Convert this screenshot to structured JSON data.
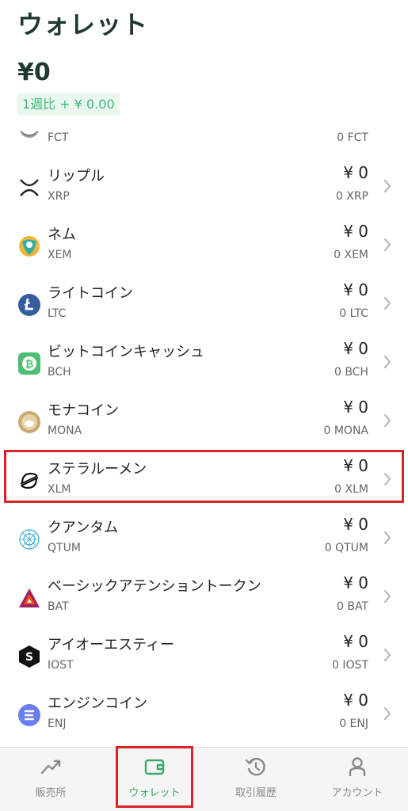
{
  "header": {
    "title": "ウォレット",
    "total": "¥0",
    "weekly_change": "1週比 + ¥ 0.00"
  },
  "coins": [
    {
      "name": "",
      "symbol": "FCT",
      "value": "",
      "amount": "0 FCT",
      "icon": "factom-icon"
    },
    {
      "name": "リップル",
      "symbol": "XRP",
      "value": "¥ 0",
      "amount": "0 XRP",
      "icon": "ripple-icon"
    },
    {
      "name": "ネム",
      "symbol": "XEM",
      "value": "¥ 0",
      "amount": "0 XEM",
      "icon": "nem-icon"
    },
    {
      "name": "ライトコイン",
      "symbol": "LTC",
      "value": "¥ 0",
      "amount": "0 LTC",
      "icon": "litecoin-icon"
    },
    {
      "name": "ビットコインキャッシュ",
      "symbol": "BCH",
      "value": "¥ 0",
      "amount": "0 BCH",
      "icon": "bitcoin-cash-icon"
    },
    {
      "name": "モナコイン",
      "symbol": "MONA",
      "value": "¥ 0",
      "amount": "0 MONA",
      "icon": "monacoin-icon"
    },
    {
      "name": "ステラルーメン",
      "symbol": "XLM",
      "value": "¥ 0",
      "amount": "0 XLM",
      "icon": "stellar-icon"
    },
    {
      "name": "クアンタム",
      "symbol": "QTUM",
      "value": "¥ 0",
      "amount": "0 QTUM",
      "icon": "qtum-icon"
    },
    {
      "name": "ベーシックアテンショントークン",
      "symbol": "BAT",
      "value": "¥ 0",
      "amount": "0 BAT",
      "icon": "bat-icon"
    },
    {
      "name": "アイオーエスティー",
      "symbol": "IOST",
      "value": "¥ 0",
      "amount": "0 IOST",
      "icon": "iost-icon"
    },
    {
      "name": "エンジンコイン",
      "symbol": "ENJ",
      "value": "¥ 0",
      "amount": "0 ENJ",
      "icon": "enjin-icon"
    }
  ],
  "tabbar": {
    "tabs": [
      {
        "label": "販売所",
        "icon": "chart-trend-icon"
      },
      {
        "label": "ウォレット",
        "icon": "wallet-icon"
      },
      {
        "label": "取引履歴",
        "icon": "history-icon"
      },
      {
        "label": "アカウント",
        "icon": "user-icon"
      }
    ],
    "active": "ウォレット"
  },
  "colors": {
    "accent": "#3aa66c",
    "highlight": "#d9232b",
    "title": "#1f3a33"
  }
}
